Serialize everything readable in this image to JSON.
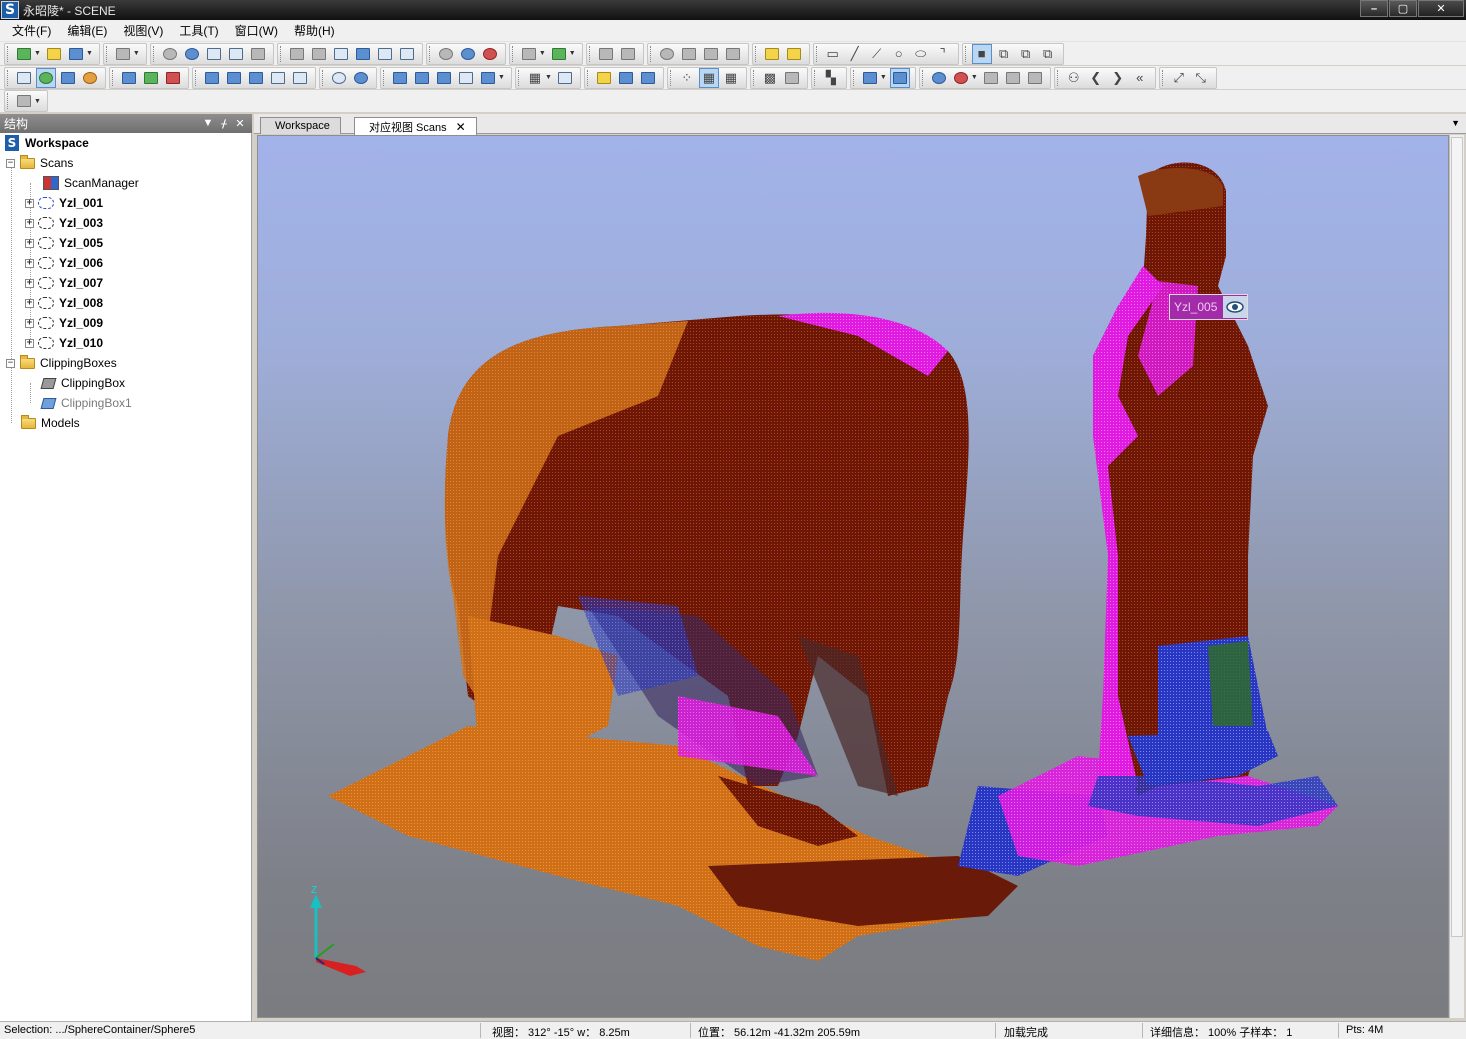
{
  "window": {
    "title": "永昭陵* - SCENE",
    "app_icon": "S",
    "buttons": [
      "–",
      "▢",
      "✕"
    ]
  },
  "menu": [
    "文件(F)",
    "编辑(E)",
    "视图(V)",
    "工具(T)",
    "窗口(W)",
    "帮助(H)"
  ],
  "structure_panel": {
    "title": "结构",
    "tree": [
      {
        "label": "Workspace",
        "icon": "workspace-icon",
        "level": 0
      },
      {
        "label": "Scans",
        "icon": "scans-folder-icon",
        "level": 1
      },
      {
        "label": "ScanManager",
        "icon": "scan-manager-icon",
        "level": 2
      },
      {
        "label": "Yzl_001",
        "icon": "scan-icon",
        "level": 2
      },
      {
        "label": "Yzl_003",
        "icon": "scan-icon",
        "level": 2
      },
      {
        "label": "Yzl_005",
        "icon": "scan-icon",
        "level": 2
      },
      {
        "label": "Yzl_006",
        "icon": "scan-icon",
        "level": 2
      },
      {
        "label": "Yzl_007",
        "icon": "scan-icon",
        "level": 2
      },
      {
        "label": "Yzl_008",
        "icon": "scan-icon",
        "level": 2
      },
      {
        "label": "Yzl_009",
        "icon": "scan-icon",
        "level": 2
      },
      {
        "label": "Yzl_010",
        "icon": "scan-icon",
        "level": 2
      },
      {
        "label": "ClippingBoxes",
        "icon": "folder-icon",
        "level": 1
      },
      {
        "label": "ClippingBox",
        "icon": "clipping-box-icon",
        "level": 2
      },
      {
        "label": "ClippingBox1",
        "icon": "clipping-box-icon",
        "level": 2
      },
      {
        "label": "Models",
        "icon": "folder-icon",
        "level": 1
      }
    ]
  },
  "tabs": [
    {
      "label": "Workspace",
      "active": false
    },
    {
      "label": "对应视图 Scans",
      "active": true,
      "close": "✕"
    }
  ],
  "viewport": {
    "scan_label": "Yzl_005",
    "axis_label": "Z",
    "colors": {
      "orange": "#d2731c",
      "dark_red": "#6b1408",
      "magenta": "#e21be0",
      "blue": "#2638c8",
      "green": "#2f6b2c"
    }
  },
  "status": {
    "selection": "Selection: .../SphereContainer/Sphere5",
    "view": "视图： 312° -15° w： 8.25m",
    "position": "位置： 56.12m -41.32m 205.59m",
    "load": "加载完成",
    "detail": "详细信息： 100%  子样本： 1",
    "pts": "Pts: 4M"
  }
}
